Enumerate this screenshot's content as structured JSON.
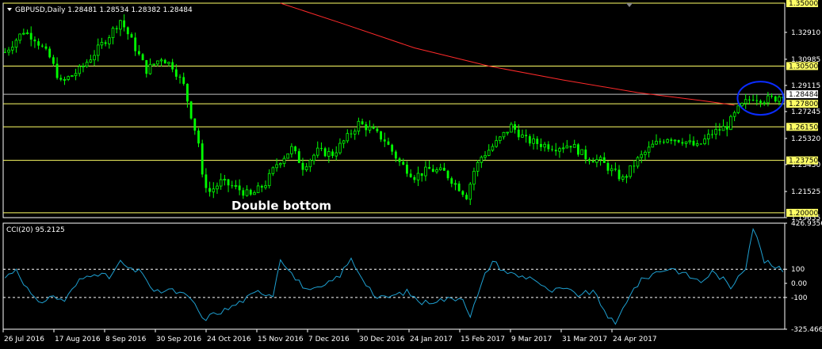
{
  "window": {
    "symbol_header": "GBPUSD,Daily  1.28481 1.28534 1.28382 1.28484",
    "annotation": "Double bottom"
  },
  "colors": {
    "background": "#000000",
    "frame": "#ffffff",
    "bull_candle": "#00ff00",
    "bear_candle": "#00ff00",
    "support_resistance": "#ffff66",
    "moving_average": "#ff2a2a",
    "cci_line": "#1e9fd0",
    "circle": "#0a2cff",
    "current_price_line": "#c0c0c0"
  },
  "chart_data": [
    {
      "type": "candlestick",
      "title": "GBPUSD,Daily",
      "ohlc_last": {
        "open": 1.28481,
        "high": 1.28534,
        "low": 1.28382,
        "close": 1.28484
      },
      "ylim": [
        1.19655,
        1.35
      ],
      "y_ticks": [
        1.3291,
        1.30985,
        1.29115,
        1.27245,
        1.2532,
        1.2345,
        1.21525,
        1.19655
      ],
      "y_tick_labels": [
        "1.32910",
        "1.30985",
        "1.29115",
        "1.27245",
        "1.25320",
        "1.23450",
        "1.21525",
        "1.19655"
      ],
      "current_price": 1.28484,
      "current_price_label": "1.28484",
      "levels": [
        {
          "value": 1.35,
          "label": "1.35000"
        },
        {
          "value": 1.305,
          "label": "1.30500"
        },
        {
          "value": 1.278,
          "label": "1.27800"
        },
        {
          "value": 1.2615,
          "label": "1.26150"
        },
        {
          "value": 1.2375,
          "label": "1.23750"
        },
        {
          "value": 1.2,
          "label": "1.20000"
        }
      ],
      "x_labels": [
        "26 Jul 2016",
        "17 Aug 2016",
        "8 Sep 2016",
        "30 Sep 2016",
        "24 Oct 2016",
        "15 Nov 2016",
        "7 Dec 2016",
        "30 Dec 2016",
        "24 Jan 2017",
        "15 Feb 2017",
        "9 Mar 2017",
        "31 Mar 2017",
        "24 Apr 2017"
      ],
      "close_path": [
        [
          0,
          1.315
        ],
        [
          5,
          1.33
        ],
        [
          8,
          1.325
        ],
        [
          12,
          1.311
        ],
        [
          15,
          1.293
        ],
        [
          20,
          1.302
        ],
        [
          24,
          1.314
        ],
        [
          28,
          1.327
        ],
        [
          31,
          1.338
        ],
        [
          34,
          1.323
        ],
        [
          38,
          1.302
        ],
        [
          42,
          1.311
        ],
        [
          45,
          1.305
        ],
        [
          48,
          1.291
        ],
        [
          50,
          1.27
        ],
        [
          52,
          1.25
        ],
        [
          53,
          1.225
        ],
        [
          55,
          1.215
        ],
        [
          58,
          1.222
        ],
        [
          62,
          1.218
        ],
        [
          66,
          1.212
        ],
        [
          70,
          1.221
        ],
        [
          73,
          1.235
        ],
        [
          77,
          1.246
        ],
        [
          80,
          1.233
        ],
        [
          84,
          1.244
        ],
        [
          88,
          1.242
        ],
        [
          92,
          1.254
        ],
        [
          95,
          1.264
        ],
        [
          98,
          1.26
        ],
        [
          102,
          1.252
        ],
        [
          106,
          1.236
        ],
        [
          110,
          1.226
        ],
        [
          114,
          1.231
        ],
        [
          118,
          1.229
        ],
        [
          122,
          1.218
        ],
        [
          124,
          1.212
        ],
        [
          126,
          1.23
        ],
        [
          128,
          1.24
        ],
        [
          132,
          1.25
        ],
        [
          136,
          1.262
        ],
        [
          140,
          1.252
        ],
        [
          144,
          1.249
        ],
        [
          148,
          1.247
        ],
        [
          152,
          1.249
        ],
        [
          156,
          1.24
        ],
        [
          160,
          1.237
        ],
        [
          163,
          1.23
        ],
        [
          166,
          1.224
        ],
        [
          170,
          1.238
        ],
        [
          174,
          1.248
        ],
        [
          178,
          1.254
        ],
        [
          182,
          1.252
        ],
        [
          186,
          1.247
        ],
        [
          190,
          1.257
        ],
        [
          194,
          1.262
        ],
        [
          197,
          1.274
        ],
        [
          199,
          1.279
        ],
        [
          201,
          1.283
        ],
        [
          204,
          1.281
        ],
        [
          207,
          1.282
        ],
        [
          209,
          1.285
        ]
      ],
      "series": [
        {
          "name": "",
          "kind": "moving_average",
          "x": [
            74,
            90,
            110,
            130,
            150,
            170,
            188,
            196
          ],
          "y": [
            1.35,
            1.336,
            1.318,
            1.305,
            1.295,
            1.286,
            1.28,
            1.277
          ]
        }
      ]
    },
    {
      "type": "line",
      "title": "CCI(20) 95.2125",
      "ylim": [
        -325.4667,
        426.9356
      ],
      "y_ticks": [
        426.9356,
        100,
        0.0,
        -100,
        -325.4667
      ],
      "y_tick_labels": [
        "426.9356",
        "100",
        "0.00",
        "-100",
        "-325.4667"
      ],
      "levels": [
        100,
        -100
      ],
      "series": [
        {
          "name": "",
          "x": [
            0,
            3,
            6,
            9,
            12,
            16,
            20,
            24,
            28,
            31,
            34,
            37,
            40,
            44,
            48,
            51,
            53,
            56,
            60,
            64,
            68,
            72,
            74,
            76,
            78,
            82,
            86,
            90,
            93,
            96,
            100,
            104,
            108,
            112,
            116,
            120,
            123,
            125,
            127,
            129,
            131,
            134,
            138,
            142,
            146,
            150,
            154,
            158,
            162,
            164,
            166,
            168,
            171,
            175,
            179,
            183,
            187,
            190,
            193,
            195,
            197,
            199,
            201,
            204,
            207,
            209
          ],
          "y": [
            40,
            105,
            -40,
            -150,
            -90,
            -120,
            20,
            80,
            40,
            150,
            90,
            80,
            -70,
            -45,
            -80,
            -140,
            -260,
            -220,
            -180,
            -120,
            -60,
            -80,
            180,
            110,
            30,
            -60,
            -20,
            60,
            170,
            40,
            -110,
            -90,
            -60,
            -140,
            -120,
            -110,
            -100,
            -230,
            -90,
            60,
            160,
            90,
            50,
            40,
            -60,
            -40,
            -80,
            -60,
            -230,
            -300,
            -180,
            -70,
            20,
            80,
            110,
            60,
            10,
            80,
            30,
            -40,
            60,
            120,
            400,
            160,
            110,
            95
          ]
        }
      ]
    }
  ]
}
